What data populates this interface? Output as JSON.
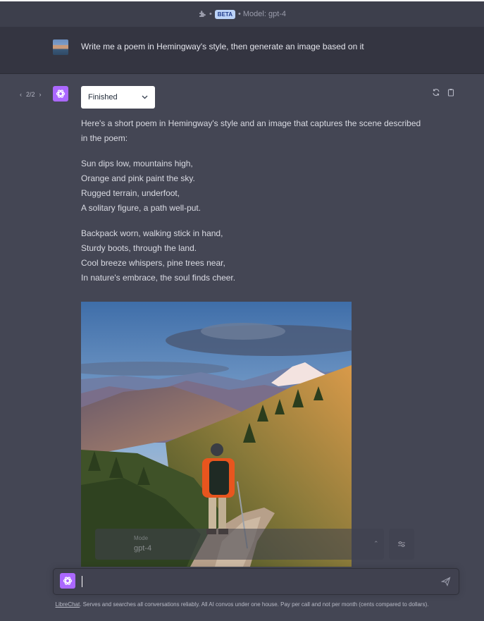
{
  "header": {
    "plugin_icon": "puzzle-icon",
    "badge": "BETA",
    "model_text": "• Model: gpt-4"
  },
  "user_message": {
    "text": "Write me a poem in Hemingway's style, then generate an image based on it"
  },
  "assistant_message": {
    "pager": "2/2",
    "status": "Finished",
    "intro": "Here's a short poem in Hemingway's style and an image that captures the scene described in the poem:",
    "stanza1": [
      "Sun dips low, mountains high,",
      "Orange and pink paint the sky.",
      "Rugged terrain, underfoot,",
      "A solitary figure, a path well-put."
    ],
    "stanza2": [
      "Backpack worn, walking stick in hand,",
      "Sturdy boots, through the land.",
      "Cool breeze whispers, pine trees near,",
      "In nature's embrace, the soul finds cheer."
    ]
  },
  "model_selector": {
    "caption": "Mode",
    "model": "gpt-4"
  },
  "input": {
    "placeholder": ""
  },
  "footer": {
    "link": "LibreChat",
    "text": ". Serves and searches all conversations reliably. All AI convos under one house. Pay per call and not per month (cents compared to dollars)."
  },
  "colors": {
    "accent": "#ab68ff",
    "background": "#444654",
    "user_row": "#343541"
  }
}
